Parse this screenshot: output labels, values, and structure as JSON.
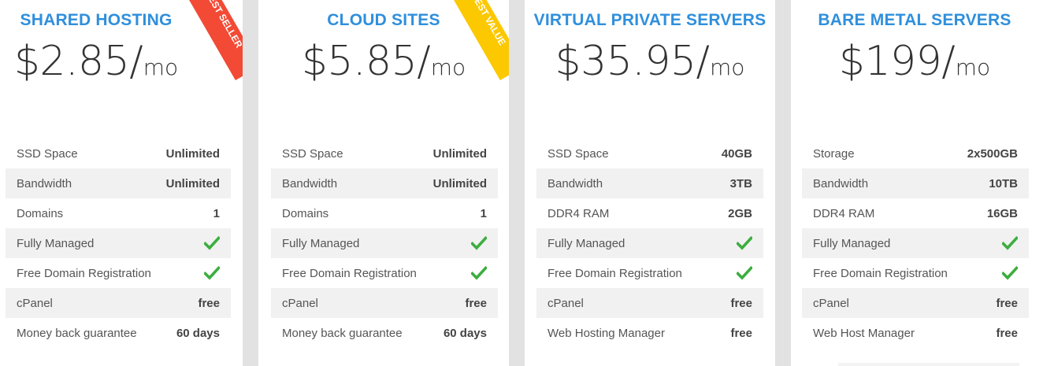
{
  "colors": {
    "title": "#2f8fdc",
    "check": "#3cae3f",
    "ribbon_red": "#f24a35",
    "ribbon_yellow": "#fcc800",
    "background": "#e2e2e2"
  },
  "plans": [
    {
      "title": "SHARED HOSTING",
      "price": "$2.85",
      "slash": "/",
      "unit": "mo",
      "ribbon": "BEST SELLER",
      "features": [
        {
          "label": "SSD Space",
          "value": "Unlimited"
        },
        {
          "label": "Bandwidth",
          "value": "Unlimited"
        },
        {
          "label": "Domains",
          "value": "1"
        },
        {
          "label": "Fully Managed",
          "value": "",
          "icon": "check-icon"
        },
        {
          "label": "Free Domain Registration",
          "value": "",
          "icon": "check-icon"
        },
        {
          "label": "cPanel",
          "value": "free"
        },
        {
          "label": "Money back guarantee",
          "value": "60 days"
        }
      ]
    },
    {
      "title": "CLOUD SITES",
      "price": "$5.85",
      "slash": "/",
      "unit": "mo",
      "ribbon": "BEST VALUE",
      "features": [
        {
          "label": "SSD Space",
          "value": "Unlimited"
        },
        {
          "label": "Bandwidth",
          "value": "Unlimited"
        },
        {
          "label": "Domains",
          "value": "1"
        },
        {
          "label": "Fully Managed",
          "value": "",
          "icon": "check-icon"
        },
        {
          "label": "Free Domain Registration",
          "value": "",
          "icon": "check-icon"
        },
        {
          "label": "cPanel",
          "value": "free"
        },
        {
          "label": "Money back guarantee",
          "value": "60 days"
        }
      ]
    },
    {
      "title": "VIRTUAL PRIVATE SERVERS",
      "price": "$35.95",
      "slash": "/",
      "unit": "mo",
      "features": [
        {
          "label": "SSD Space",
          "value": "40GB"
        },
        {
          "label": "Bandwidth",
          "value": "3TB"
        },
        {
          "label": "DDR4 RAM",
          "value": "2GB"
        },
        {
          "label": "Fully Managed",
          "value": "",
          "icon": "check-icon"
        },
        {
          "label": "Free Domain Registration",
          "value": "",
          "icon": "check-icon"
        },
        {
          "label": "cPanel",
          "value": "free"
        },
        {
          "label": "Web Hosting Manager",
          "value": "free"
        }
      ]
    },
    {
      "title": "BARE METAL SERVERS",
      "price": "$199",
      "slash": "/",
      "unit": "mo",
      "features": [
        {
          "label": "Storage",
          "value": "2x500GB"
        },
        {
          "label": "Bandwidth",
          "value": "10TB"
        },
        {
          "label": "DDR4 RAM",
          "value": "16GB"
        },
        {
          "label": "Fully Managed",
          "value": "",
          "icon": "check-icon"
        },
        {
          "label": "Free Domain Registration",
          "value": "",
          "icon": "check-icon"
        },
        {
          "label": "cPanel",
          "value": "free"
        },
        {
          "label": "Web Host Manager",
          "value": "free"
        }
      ]
    }
  ]
}
